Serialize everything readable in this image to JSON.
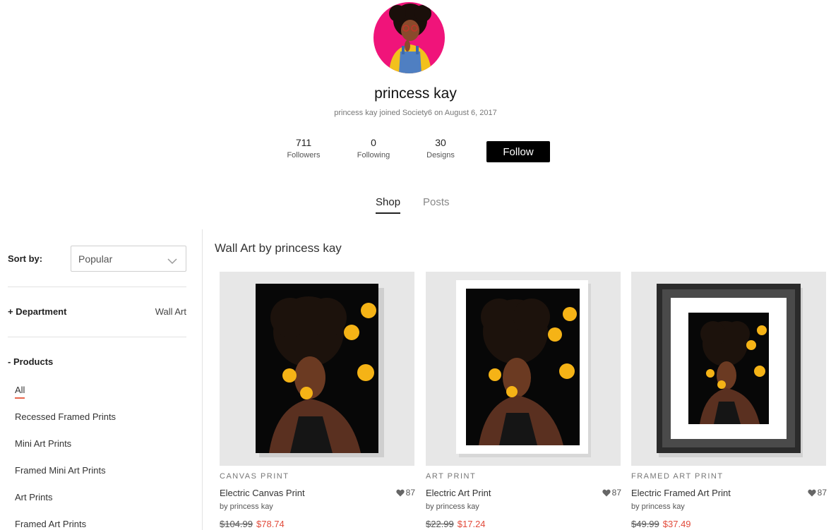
{
  "profile": {
    "name": "princess kay",
    "joined": "princess kay joined Society6 on August 6, 2017",
    "stats": [
      {
        "value": "711",
        "label": "Followers"
      },
      {
        "value": "0",
        "label": "Following"
      },
      {
        "value": "30",
        "label": "Designs"
      }
    ],
    "follow_label": "Follow"
  },
  "tabs": [
    {
      "label": "Shop",
      "active": true
    },
    {
      "label": "Posts",
      "active": false
    }
  ],
  "sidebar": {
    "sort_label": "Sort by:",
    "sort_value": "Popular",
    "department_label": "+ Department",
    "department_value": "Wall Art",
    "products_label": "- Products",
    "products": [
      "All",
      "Recessed Framed Prints",
      "Mini Art Prints",
      "Framed Mini Art Prints",
      "Art Prints",
      "Framed Art Prints"
    ],
    "selected_product": "All"
  },
  "main": {
    "section_title": "Wall Art by princess kay",
    "cards": [
      {
        "type": "CANVAS PRINT",
        "title": "Electric Canvas Print",
        "by": "by princess kay",
        "likes": "87",
        "old_price": "$104.99",
        "new_price": "$78.74",
        "style": "canvas"
      },
      {
        "type": "ART PRINT",
        "title": "Electric Art Print",
        "by": "by princess kay",
        "likes": "87",
        "old_price": "$22.99",
        "new_price": "$17.24",
        "style": "print"
      },
      {
        "type": "FRAMED ART PRINT",
        "title": "Electric Framed Art Print",
        "by": "by princess kay",
        "likes": "87",
        "old_price": "$49.99",
        "new_price": "$37.49",
        "style": "framed"
      }
    ]
  },
  "colors": {
    "accent_underline": "#e8654c",
    "sale_price": "#e24b3b",
    "follow_button": "#000000",
    "avatar_background": "#f0147a",
    "artwork_glow": "#f5b316"
  },
  "icons": {
    "likes": "heart-icon",
    "sort": "chevron-down-icon"
  }
}
